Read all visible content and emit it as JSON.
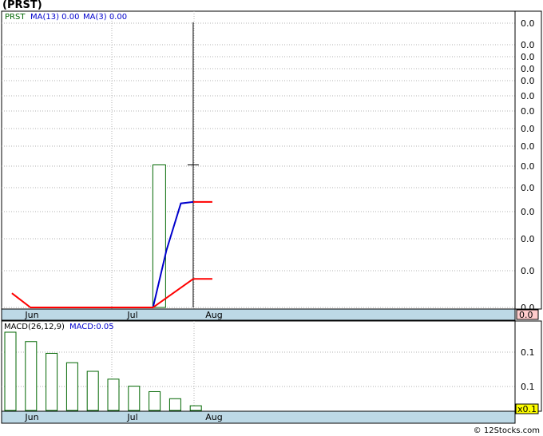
{
  "title": "(PRST)",
  "credit": "© 12Stocks.com",
  "colors": {
    "price": "#006600",
    "ma": "#0000cc",
    "signal": "#ff0000",
    "axis_bg": "#bdd9e6",
    "grid": "#b0b0b0",
    "last_value_bg": "#ffcccc",
    "multiplier_bg": "#ffff00"
  },
  "chart_data": [
    {
      "type": "bar",
      "title": "PRST",
      "legend": [
        {
          "label": "PRST",
          "color": "#006600"
        },
        {
          "label": "MA(13)  0.00",
          "color": "#0000cc"
        },
        {
          "label": "MA(3)  0.00",
          "color": "#0000cc"
        }
      ],
      "x_labels": [
        "Jun",
        "Jul",
        "Aug"
      ],
      "y_tick_labels": [
        "0.0",
        "0.0",
        "0.0",
        "0.0",
        "0.0",
        "0.0",
        "0.0",
        "0.0",
        "0.0",
        "0.0",
        "0.0",
        "0.0",
        "0.0",
        "0.0",
        "0.0"
      ],
      "last_value": "0.0",
      "ylim": [
        0,
        1
      ],
      "series": [
        {
          "name": "PRST",
          "kind": "candle",
          "x": [
            7.65
          ],
          "open": [
            0
          ],
          "close": [
            0.5
          ]
        },
        {
          "name": "MA(13)",
          "kind": "line",
          "x": [
            7.35,
            8.0,
            8.7,
            9.3
          ],
          "values": [
            0,
            0.2,
            0.365,
            0.37
          ]
        },
        {
          "name": "MA(3)",
          "kind": "line",
          "x": [
            0.5,
            1.4,
            7.35,
            9.3
          ],
          "values": [
            0.05,
            0,
            0,
            0.1
          ]
        }
      ],
      "wick": {
        "x": 9.3,
        "low": 0,
        "high": 1.0,
        "tick": 0.5
      }
    },
    {
      "type": "bar",
      "title": "MACD(26,12,9)",
      "legend": [
        {
          "label": "MACD(26,12,9)",
          "color": "#000000"
        },
        {
          "label": "MACD:0.05",
          "color": "#0000cc"
        }
      ],
      "x_labels": [
        "Jun",
        "Jul",
        "Aug"
      ],
      "y_tick_labels": [
        "0.1",
        "0.1",
        "0.1"
      ],
      "multiplier": "x0.1",
      "ylim": [
        0,
        1
      ],
      "values": [
        1.0,
        0.88,
        0.73,
        0.61,
        0.5,
        0.4,
        0.31,
        0.24,
        0.15,
        0.06
      ]
    }
  ]
}
